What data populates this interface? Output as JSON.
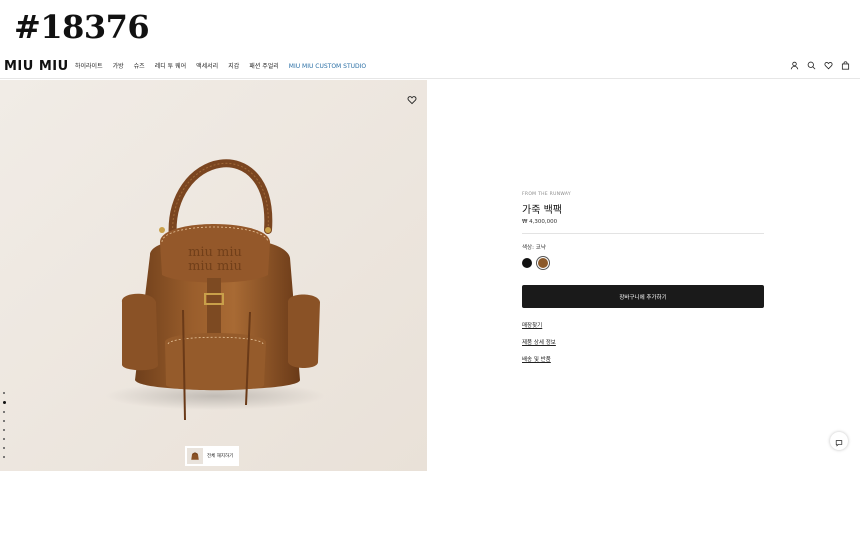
{
  "overlay_id": "#18376",
  "brand": "MIU MIU",
  "nav": {
    "links": [
      "하이라이트",
      "가방",
      "슈즈",
      "레디 투 웨어",
      "액세서리",
      "지갑",
      "패션 주얼리",
      "MIU MIU CUSTOM STUDIO"
    ],
    "icons": [
      "user-icon",
      "search-icon",
      "heart-icon",
      "bag-icon"
    ]
  },
  "hero": {
    "try_on_label": "전체 해지하기",
    "gallery_dots": 8,
    "active_dot": 1
  },
  "product": {
    "eyebrow": "FROM THE RUNWAY",
    "title": "가죽 백팩",
    "price": "₩ 4,300,000",
    "color_label": "색상: 코냑",
    "swatches": [
      {
        "name": "black",
        "color": "#111111"
      },
      {
        "name": "cognac",
        "color": "#8c5a2b"
      }
    ],
    "cta_label": "장바구니에 추가하기",
    "links": [
      "매장찾기",
      "제품 상세 정보",
      "배송 및 반품"
    ]
  }
}
